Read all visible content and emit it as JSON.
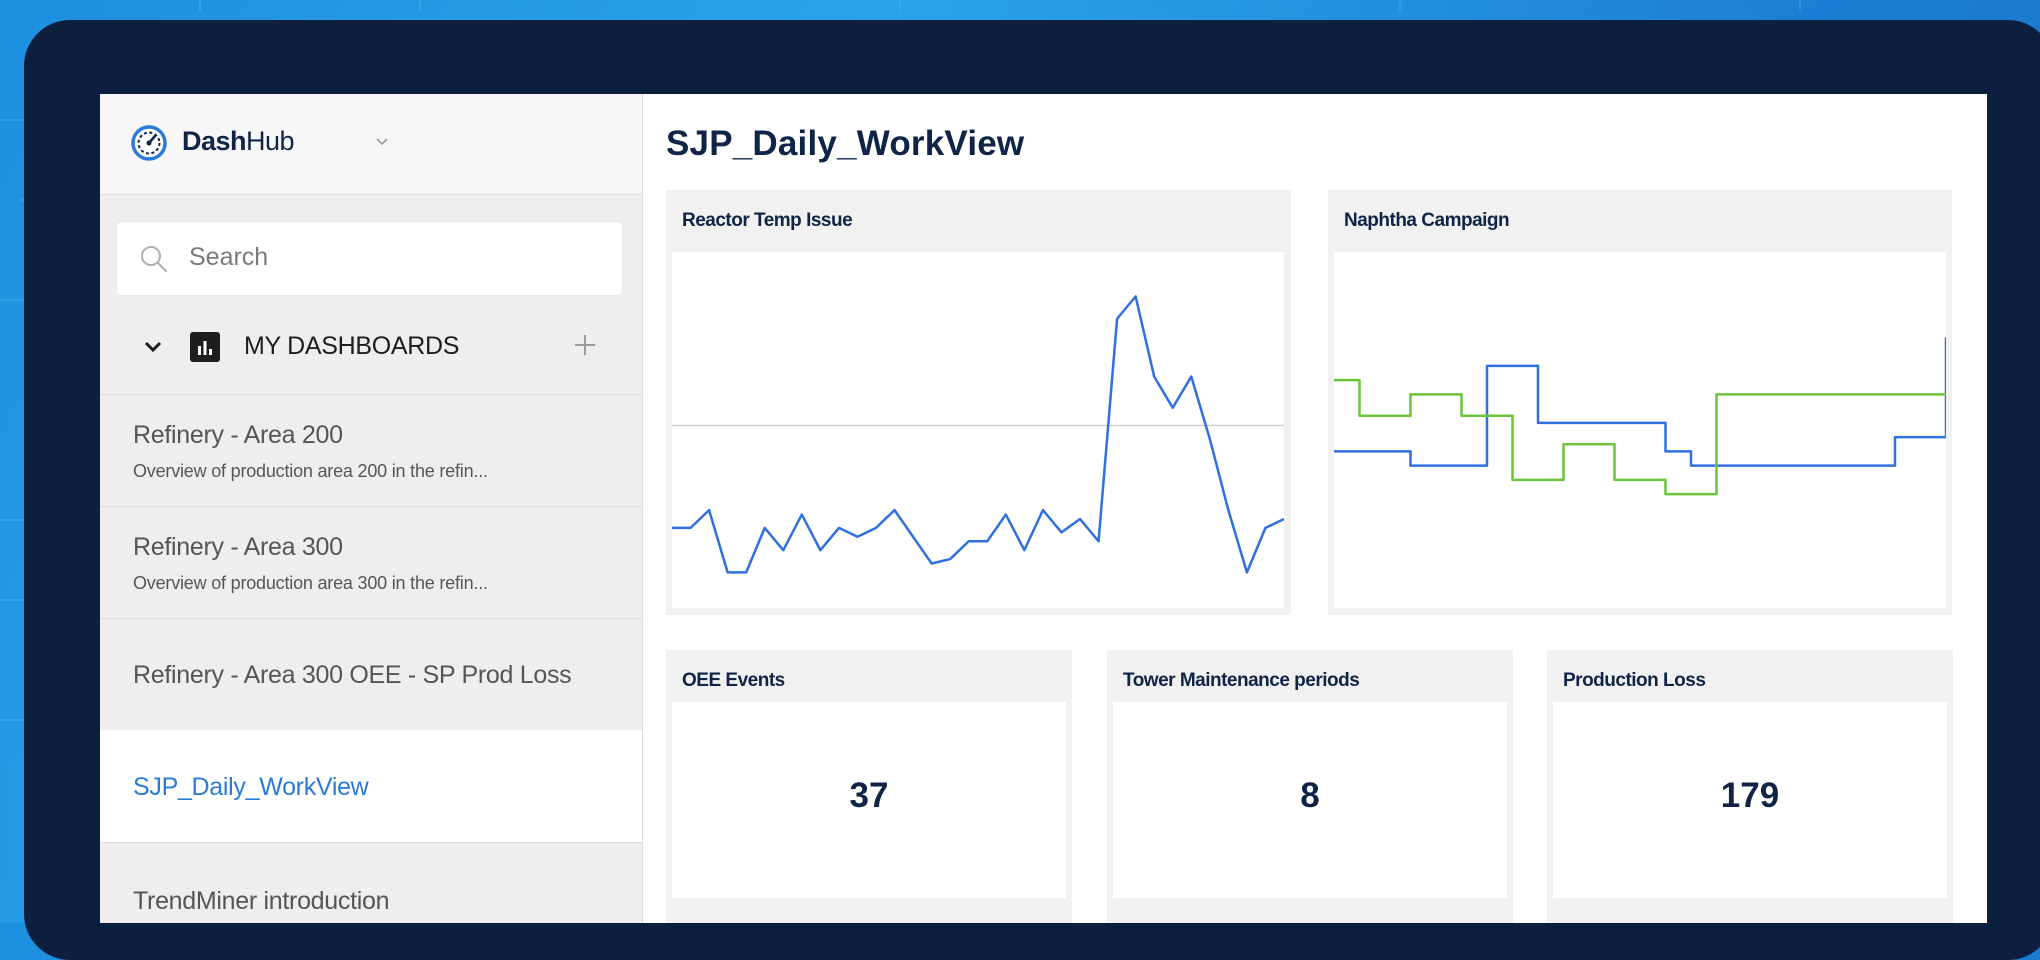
{
  "brand": {
    "name_bold": "Dash",
    "name_light": "Hub"
  },
  "search": {
    "placeholder": "Search"
  },
  "sidebar": {
    "section_label": "MY DASHBOARDS",
    "items": [
      {
        "title": "Refinery - Area 200",
        "description": "Overview of production area 200 in the refin...",
        "active": false
      },
      {
        "title": "Refinery - Area 300",
        "description": "Overview of production area 300 in the refin...",
        "active": false
      },
      {
        "title": "Refinery - Area 300 OEE - SP Prod Loss",
        "description": "",
        "active": false
      },
      {
        "title": "SJP_Daily_WorkView",
        "description": "",
        "active": true
      },
      {
        "title": "TrendMiner introduction",
        "description": "",
        "active": false
      }
    ]
  },
  "main": {
    "title": "SJP_Daily_WorkView",
    "widgets": {
      "reactor": {
        "title": "Reactor Temp Issue"
      },
      "naphtha": {
        "title": "Naphtha Campaign"
      },
      "oee": {
        "title": "OEE Events",
        "value": "37"
      },
      "tower": {
        "title": "Tower Maintenance periods",
        "value": "8"
      },
      "loss": {
        "title": "Production Loss",
        "value": "179"
      }
    }
  },
  "colors": {
    "line_blue": "#2f6fe0",
    "line_green": "#6cc43a",
    "navy": "#0f2447",
    "active_link": "#2b7bd8"
  },
  "chart_data": [
    {
      "type": "line",
      "title": "Reactor Temp Issue",
      "series": [
        {
          "values": [
            48,
            48,
            52,
            38,
            38,
            48,
            43,
            51,
            43,
            48,
            46,
            48,
            52,
            46,
            40,
            41,
            45,
            45,
            51,
            43,
            52,
            47,
            50,
            45,
            95,
            100,
            82,
            75,
            82,
            68,
            52,
            38,
            48,
            50
          ]
        }
      ],
      "reference_line": 71,
      "ylim": [
        30,
        110
      ],
      "grid": false
    },
    {
      "type": "line",
      "title": "Naphtha Campaign",
      "series": [
        {
          "values": [
            52,
            52,
            52,
            50,
            50,
            50,
            64,
            64,
            56,
            56,
            56,
            56,
            56,
            52,
            50,
            50,
            50,
            50,
            50,
            50,
            50,
            50,
            54,
            54,
            68
          ]
        },
        {
          "values": [
            62,
            57,
            57,
            60,
            60,
            57,
            57,
            48,
            48,
            53,
            53,
            48,
            48,
            46,
            46,
            60,
            60,
            60,
            60,
            60,
            60,
            60,
            60,
            60,
            60
          ]
        }
      ],
      "ylim": [
        30,
        80
      ],
      "grid": false
    }
  ]
}
